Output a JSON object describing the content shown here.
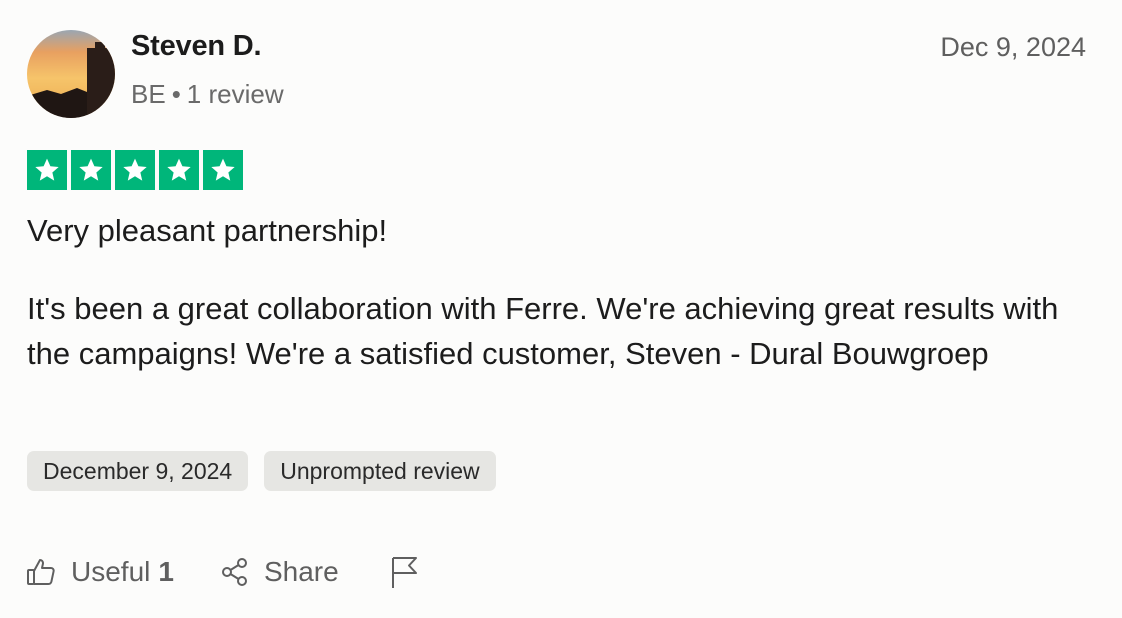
{
  "reviewer": {
    "name": "Steven D.",
    "country": "BE",
    "separator": "•",
    "review_count": "1 review"
  },
  "review": {
    "date_short": "Dec 9, 2024",
    "rating": 5,
    "title": "Very pleasant partnership!",
    "body": "It's been a great collaboration with Ferre. We're achieving great results with the campaigns! We're a satisfied customer, Steven - Dural Bouwgroep",
    "date_chip": "December 9, 2024",
    "tag_chip": "Unprompted review"
  },
  "actions": {
    "useful_label": "Useful",
    "useful_count": "1",
    "share_label": "Share"
  },
  "colors": {
    "star_green": "#00b67a",
    "chip_bg": "#e6e6e3"
  },
  "icons": [
    "thumbs-up-icon",
    "share-icon",
    "flag-icon",
    "star-icon"
  ]
}
